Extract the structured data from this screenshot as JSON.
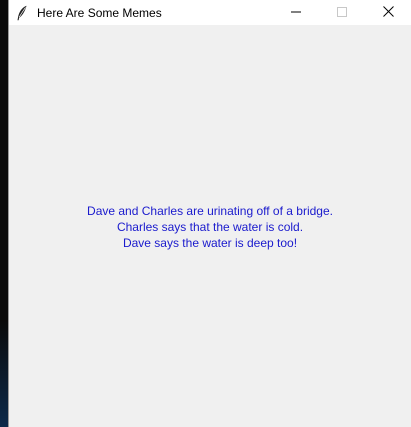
{
  "window": {
    "title": "Here Are Some Memes",
    "icon": "feather-icon"
  },
  "controls": {
    "minimize": "minimize-icon",
    "maximize": "maximize-icon",
    "close": "close-icon"
  },
  "meme": {
    "line1": "Dave and Charles are urinating off of a bridge.",
    "line2": "Charles says that the water is cold.",
    "line3": "Dave says the water is deep too!"
  },
  "colors": {
    "text": "#1a1acd",
    "background": "#f0f0f0"
  }
}
